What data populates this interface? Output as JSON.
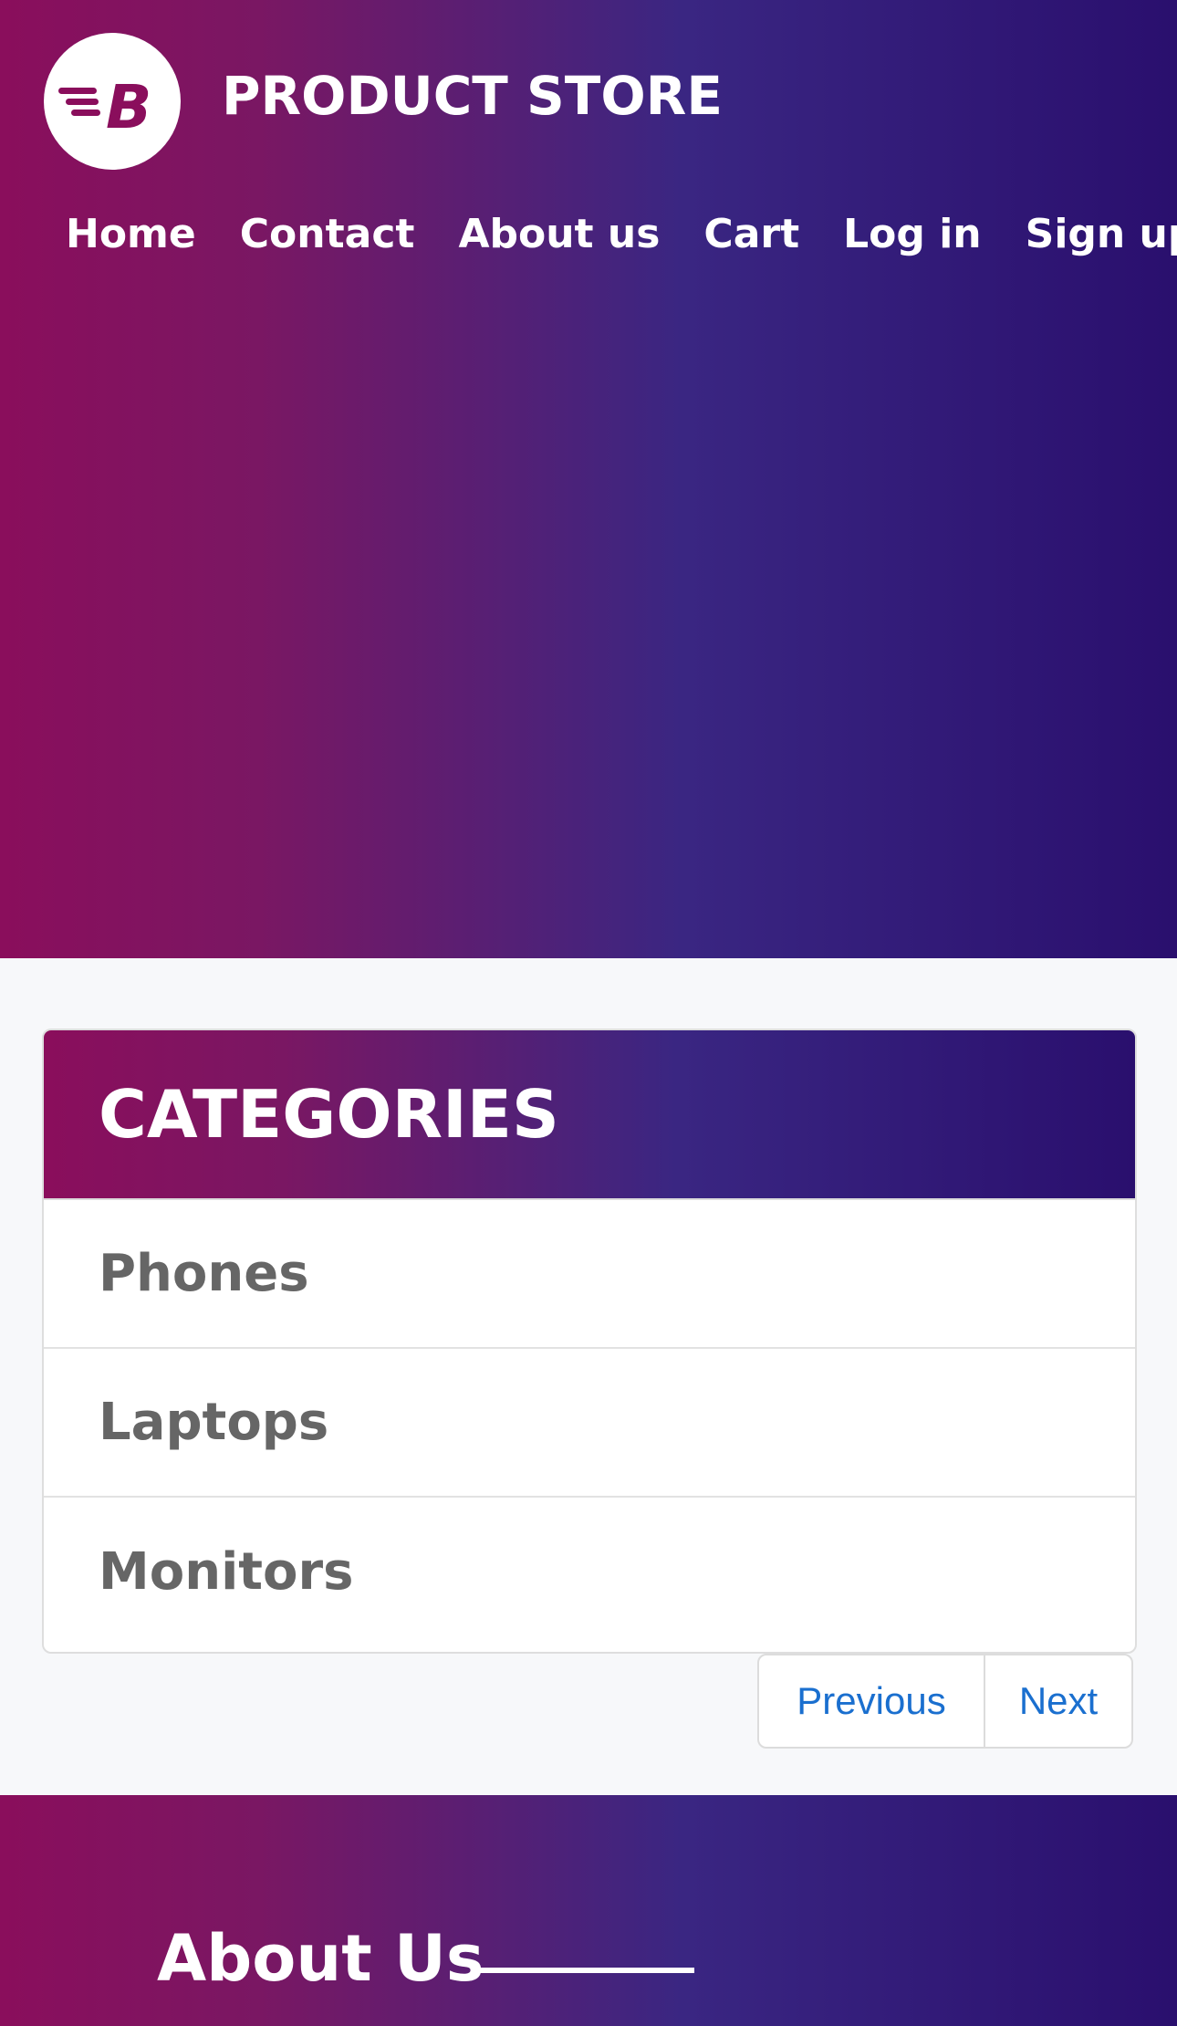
{
  "brand": {
    "logo_icon": "brand-b-logo-icon",
    "name": "PRODUCT STORE"
  },
  "nav": {
    "items": [
      "Home",
      "Contact",
      "About us",
      "Cart",
      "Log in",
      "Sign up"
    ]
  },
  "categories": {
    "title": "CATEGORIES",
    "items": [
      "Phones",
      "Laptops",
      "Monitors"
    ]
  },
  "pagination": {
    "previous": "Previous",
    "next": "Next"
  },
  "footer": {
    "about_title": "About Us"
  },
  "colors": {
    "gradient_start": "#8a0e5c",
    "gradient_end": "#2a0f6e",
    "link": "#1a6fcf",
    "category_text": "#666666"
  }
}
